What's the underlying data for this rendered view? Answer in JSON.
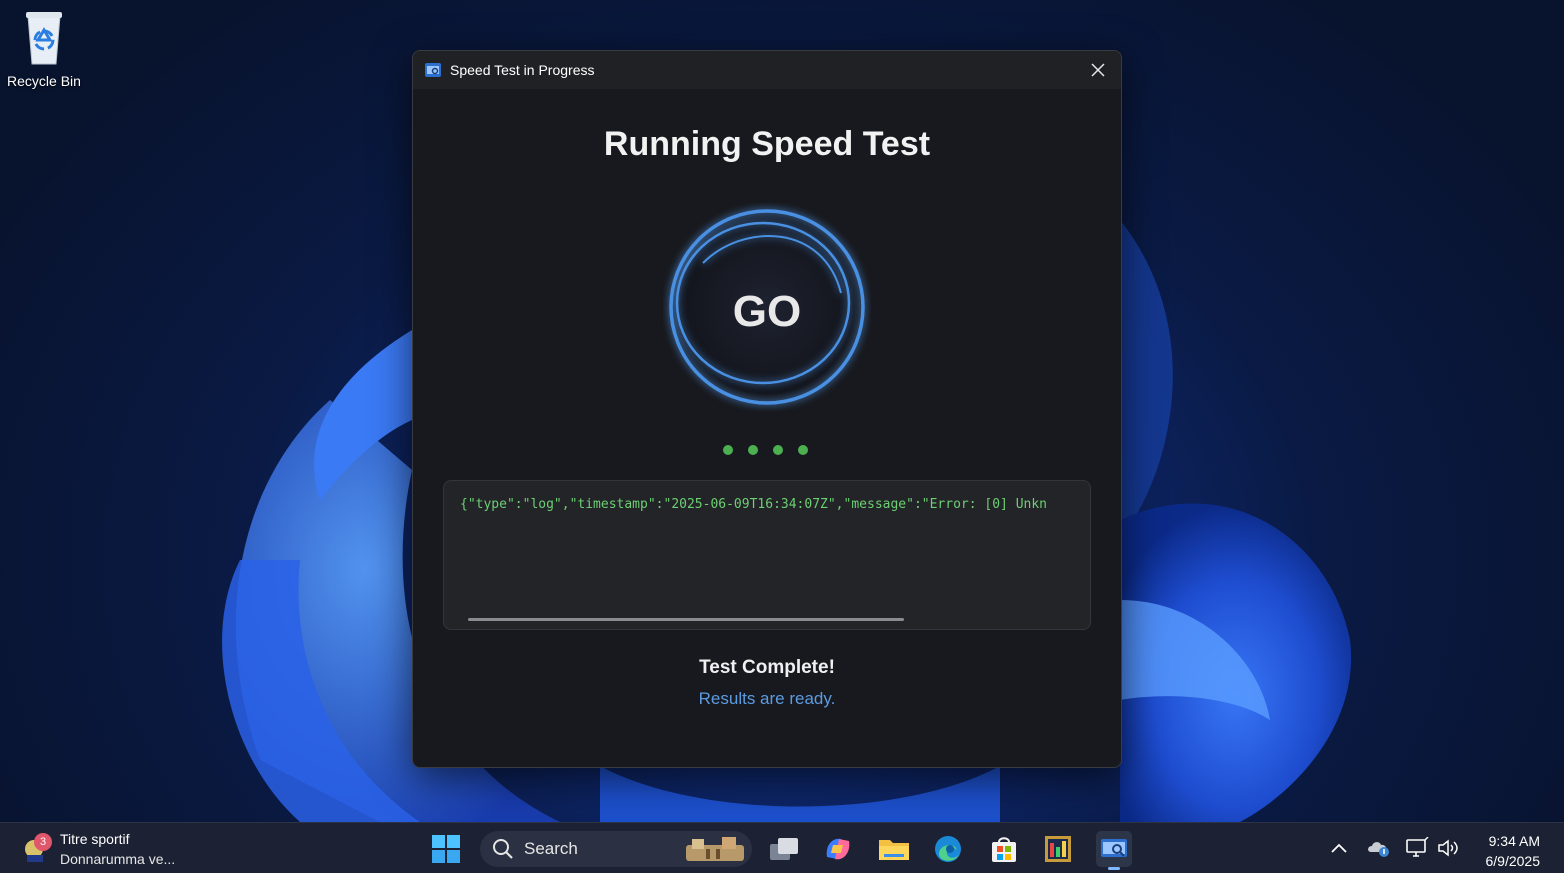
{
  "desktop": {
    "icons": [
      {
        "label": "Recycle Bin",
        "icon": "recycle-bin-icon"
      }
    ]
  },
  "dialog": {
    "window_title": "Speed Test in Progress",
    "heading": "Running Speed Test",
    "go_button_label": "GO",
    "log_text": "{\"type\":\"log\",\"timestamp\":\"2025-06-09T16:34:07Z\",\"message\":\"Error: [0] Unkn",
    "status_title": "Test Complete!",
    "status_subtitle": "Results are ready.",
    "colors": {
      "accent": "#4a90e2",
      "dots": "#4caf50",
      "log_text": "#6ccf73",
      "subtitle": "#5b9be0"
    }
  },
  "taskbar": {
    "widget": {
      "title": "Titre sportif",
      "subtitle": "Donnarumma ve...",
      "badge": "3"
    },
    "search_placeholder": "Search",
    "apps": [
      "start-icon",
      "task-view-icon",
      "copilot-icon",
      "file-explorer-icon",
      "edge-icon",
      "store-icon",
      "app-icon",
      "speedtest-app-icon"
    ],
    "tray": [
      "chevron-up-icon",
      "onedrive-icon",
      "network-icon",
      "volume-icon"
    ],
    "time": "9:34 AM",
    "date": "6/9/2025"
  }
}
